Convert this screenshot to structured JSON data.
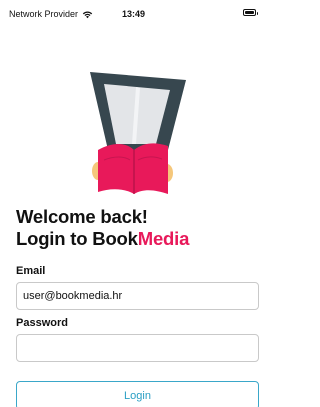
{
  "status_bar": {
    "carrier": "Network Provider",
    "time": "13:49",
    "icons": [
      "wifi-icon",
      "battery-icon"
    ]
  },
  "illustration": {
    "icon": "reading-person-illustration",
    "colors": {
      "frame": "#37474f",
      "page": "#e3e5e8",
      "book": "#e8195a",
      "hand": "#f5c77b"
    }
  },
  "heading": {
    "line1": "Welcome back!",
    "line2_prefix": "Login to Book",
    "line2_brand": "Media",
    "brand_color": "#e8195a"
  },
  "form": {
    "email_label": "Email",
    "email_value": "user@bookmedia.hr",
    "password_label": "Password",
    "password_value": "",
    "login_label": "Login",
    "accent_color": "#2a9fc4"
  }
}
